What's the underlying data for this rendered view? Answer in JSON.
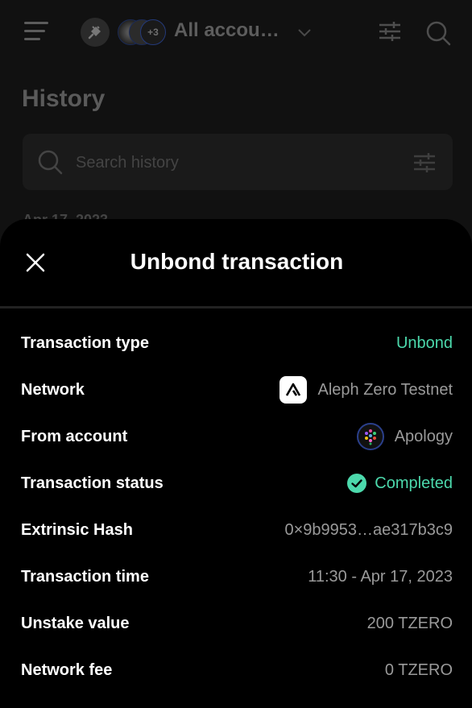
{
  "header": {
    "account_selector": "All accou…",
    "more_accounts_badge": "+3"
  },
  "page": {
    "title": "History",
    "search_placeholder": "Search history",
    "date_group_peek": "Apr 17, 2023"
  },
  "modal": {
    "title": "Unbond transaction",
    "rows": [
      {
        "label": "Transaction type",
        "value": "Unbond"
      },
      {
        "label": "Network",
        "value": "Aleph Zero Testnet",
        "icon": "aleph-zero-logo-icon"
      },
      {
        "label": "From account",
        "value": "Apology",
        "icon": "account-avatar-icon"
      },
      {
        "label": "Transaction status",
        "value": "Completed",
        "icon": "check-circle-icon"
      },
      {
        "label": "Extrinsic Hash",
        "value": "0×9b9953…ae317b3c9"
      },
      {
        "label": "Transaction time",
        "value": "11:30 - Apr 17, 2023"
      },
      {
        "label": "Unstake value",
        "value": "200 TZERO"
      },
      {
        "label": "Network fee",
        "value": "0 TZERO"
      }
    ]
  },
  "colors": {
    "accent_green": "#4cd9ac",
    "background": "#111111",
    "sheet": "#000000"
  }
}
